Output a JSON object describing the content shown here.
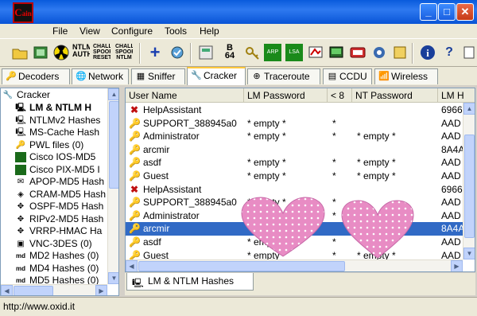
{
  "window": {
    "icon_label": "ain"
  },
  "menu": [
    "File",
    "View",
    "Configure",
    "Tools",
    "Help"
  ],
  "toolbar": {
    "labels": {
      "ntlm_auth": "NTLM AUTH",
      "chall_reset": "CHALL SPOOF RESET",
      "chall_ntlm": "CHALL SPOOF NTLM",
      "b64": "B 64",
      "arp": "ARP",
      "lsa": "LSA"
    }
  },
  "tabs": [
    "Decoders",
    "Network",
    "Sniffer",
    "Cracker",
    "Traceroute",
    "CCDU",
    "Wireless"
  ],
  "tree": {
    "root": "Cracker",
    "items": [
      "LM & NTLM H",
      "NTLMv2 Hashes",
      "MS-Cache Hash",
      "PWL files (0)",
      "Cisco IOS-MD5",
      "Cisco PIX-MD5 I",
      "APOP-MD5 Hash",
      "CRAM-MD5 Hash",
      "OSPF-MD5 Hash",
      "RIPv2-MD5 Hash",
      "VRRP-HMAC Ha",
      "VNC-3DES (0)",
      "MD2 Hashes (0)",
      "MD4 Hashes (0)",
      "MD5 Hashes (0)"
    ]
  },
  "grid": {
    "columns": [
      "User Name",
      "LM Password",
      "< 8",
      "NT Password",
      "LM H"
    ],
    "rows": [
      {
        "user": "HelpAssistant",
        "lm": "",
        "lt8": "",
        "nt": "",
        "hash": "6966"
      },
      {
        "user": "SUPPORT_388945a0",
        "lm": "* empty *",
        "lt8": "*",
        "nt": "",
        "hash": "AAD"
      },
      {
        "user": "Administrator",
        "lm": "* empty *",
        "lt8": "*",
        "nt": "* empty *",
        "hash": "AAD"
      },
      {
        "user": "arcmir",
        "lm": "",
        "lt8": "",
        "nt": "",
        "hash": "8A4A"
      },
      {
        "user": "asdf",
        "lm": "* empty *",
        "lt8": "*",
        "nt": "* empty *",
        "hash": "AAD"
      },
      {
        "user": "Guest",
        "lm": "* empty *",
        "lt8": "*",
        "nt": "* empty *",
        "hash": "AAD"
      },
      {
        "user": "HelpAssistant",
        "lm": "",
        "lt8": "",
        "nt": "",
        "hash": "6966"
      },
      {
        "user": "SUPPORT_388945a0",
        "lm": "* empty *",
        "lt8": "*",
        "nt": "",
        "hash": "AAD"
      },
      {
        "user": "Administrator",
        "lm": "* empty *",
        "lt8": "*",
        "nt": "",
        "hash": "AAD"
      },
      {
        "user": "arcmir",
        "lm": "",
        "lt8": "",
        "nt": "",
        "hash": "8A4A"
      },
      {
        "user": "asdf",
        "lm": "* empty *",
        "lt8": "*",
        "nt": "",
        "hash": "AAD"
      },
      {
        "user": "Guest",
        "lm": "* empty *",
        "lt8": "*",
        "nt": "* empty *",
        "hash": "AAD"
      }
    ]
  },
  "bottom_tab": "LM & NTLM Hashes",
  "status": "http://www.oxid.it"
}
